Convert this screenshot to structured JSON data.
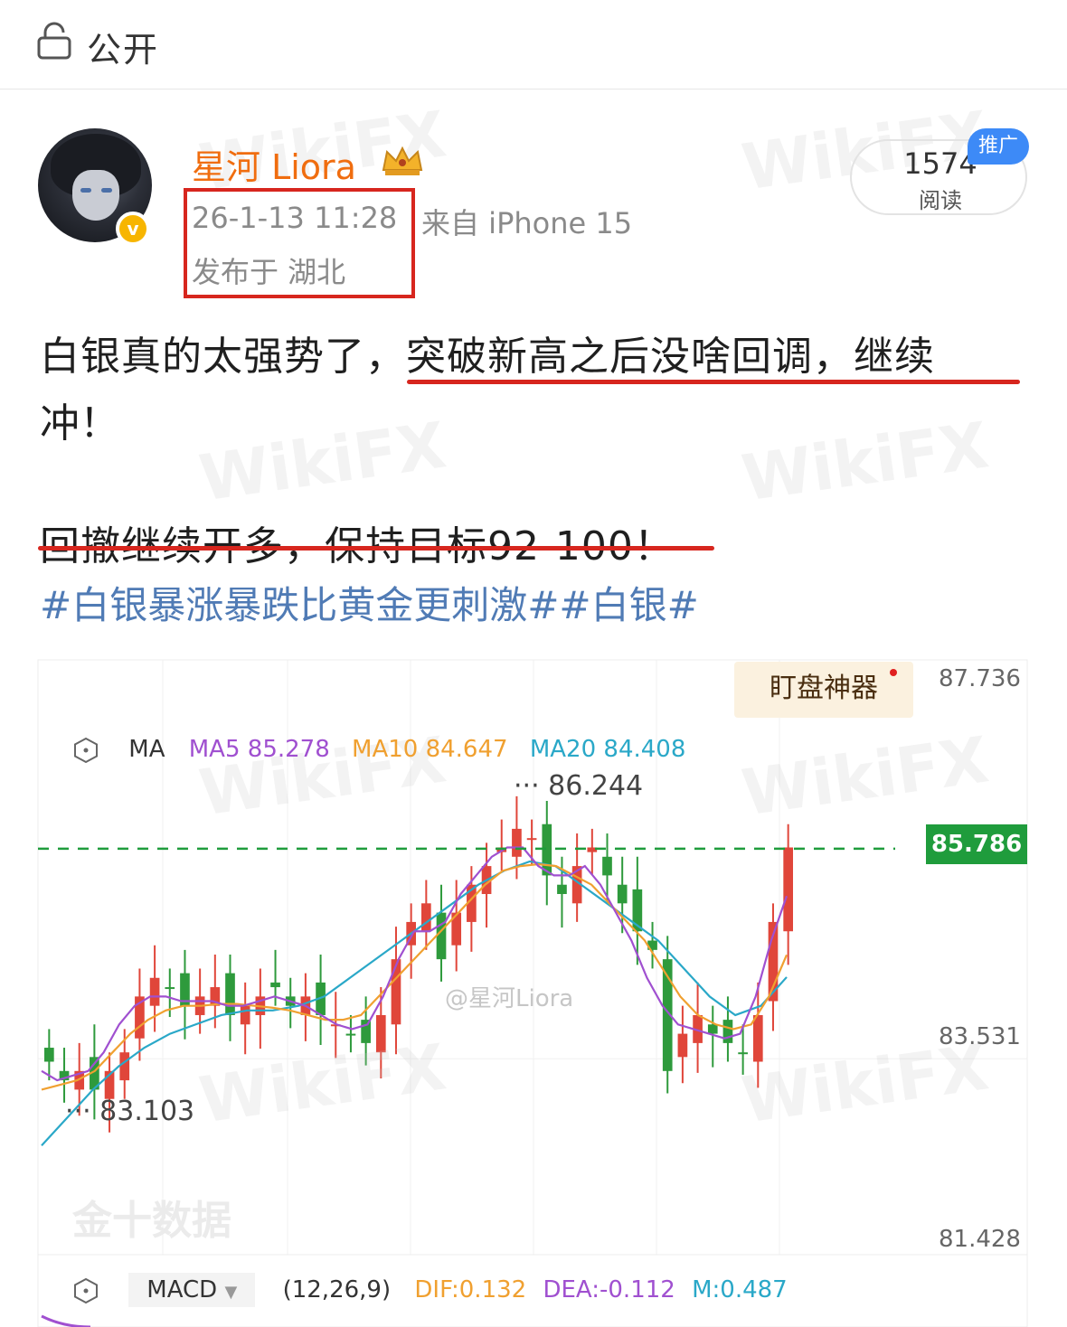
{
  "top": {
    "label": "公开",
    "icon": "lock-icon"
  },
  "author": {
    "name": "星河 Liora",
    "verified_icon": "verified-badge-icon",
    "crown_icon": "crown-icon"
  },
  "meta": {
    "time": "26-1-13 11:28",
    "source": "来自 iPhone 15",
    "location": "发布于 湖北"
  },
  "reads": {
    "count": "1574",
    "label": "阅读",
    "promo": "推广"
  },
  "post": {
    "line1": "白银真的太强势了，突破新高之后没啥回调，继续",
    "line2": "冲！",
    "line3": "回撤继续开多，保持目标92-100！",
    "hashtags": "#白银暴涨暴跌比黄金更刺激##白银#"
  },
  "watermark": {
    "brand": "WikiFX"
  },
  "chart": {
    "badge": "盯盘神器",
    "ma": {
      "label": "MA",
      "ma5": "MA5 85.278",
      "ma10": "MA10 84.647",
      "ma20": "MA20 84.408"
    },
    "current_price": "85.786",
    "annotations": {
      "high": "86.244",
      "low": "83.103"
    },
    "axis": [
      "87.736",
      "83.531",
      "81.428"
    ],
    "weibo_watermark": "@星河Liora",
    "source_watermark": "金十数据",
    "macd": {
      "select": "MACD",
      "params": "(12,26,9)",
      "dif": "DIF:0.132",
      "dea": "DEA:-0.112",
      "m": "M:0.487"
    },
    "colors": {
      "up": "#e0463a",
      "down": "#2e9a3c",
      "ma5": "#a050d0",
      "ma10": "#f0a030",
      "ma20": "#2aa8c8",
      "dashed": "#1f9c3c"
    }
  },
  "chart_data": {
    "type": "candlestick",
    "ylim": [
      81.428,
      87.736
    ],
    "reference_line": 85.786,
    "high_marker": 86.244,
    "low_marker": 83.103,
    "ohlc_shape": [
      83.5,
      83.3,
      83.4,
      83.2,
      83.4,
      83.6,
      84.2,
      84.4,
      84.3,
      84.1,
      84.2,
      84.3,
      84.0,
      84.1,
      84.2,
      84.3,
      84.1,
      84.2,
      84.0,
      83.9,
      83.8,
      83.7,
      84.0,
      84.6,
      85.0,
      85.2,
      84.6,
      85.1,
      85.4,
      85.6,
      85.8,
      86.0,
      85.9,
      85.5,
      85.3,
      85.6,
      85.8,
      85.5,
      85.2,
      84.9,
      84.7,
      83.4,
      83.8,
      84.0,
      83.8,
      83.7,
      83.6,
      84.0,
      85.0,
      85.8
    ],
    "ma5": [
      83.4,
      83.3,
      83.35,
      83.4,
      83.6,
      83.9,
      84.1,
      84.2,
      84.2,
      84.15,
      84.15,
      84.15,
      84.1,
      84.1,
      84.15,
      84.2,
      84.15,
      84.1,
      84.0,
      83.9,
      83.85,
      83.9,
      84.2,
      84.6,
      84.9,
      84.9,
      85.0,
      85.3,
      85.5,
      85.7,
      85.8,
      85.8,
      85.6,
      85.5,
      85.5,
      85.6,
      85.4,
      85.1,
      84.8,
      84.4,
      84.1,
      83.9,
      83.85,
      83.8,
      83.75,
      83.8,
      84.2,
      84.8,
      85.278
    ],
    "ma10": [
      83.2,
      83.25,
      83.3,
      83.4,
      83.6,
      83.8,
      83.95,
      84.05,
      84.1,
      84.1,
      84.12,
      84.12,
      84.1,
      84.08,
      84.05,
      84.0,
      83.95,
      83.95,
      84.0,
      84.2,
      84.4,
      84.6,
      84.8,
      85.0,
      85.2,
      85.4,
      85.55,
      85.6,
      85.62,
      85.6,
      85.5,
      85.4,
      85.2,
      85.0,
      84.8,
      84.5,
      84.2,
      84.0,
      83.9,
      83.85,
      83.9,
      84.2,
      84.647
    ],
    "ma20": [
      82.6,
      82.9,
      83.2,
      83.45,
      83.65,
      83.8,
      83.9,
      84.0,
      84.05,
      84.05,
      84.1,
      84.2,
      84.4,
      84.6,
      84.8,
      85.0,
      85.2,
      85.4,
      85.55,
      85.65,
      85.6,
      85.4,
      85.2,
      85.0,
      84.8,
      84.5,
      84.2,
      84.0,
      84.1,
      84.408
    ]
  }
}
